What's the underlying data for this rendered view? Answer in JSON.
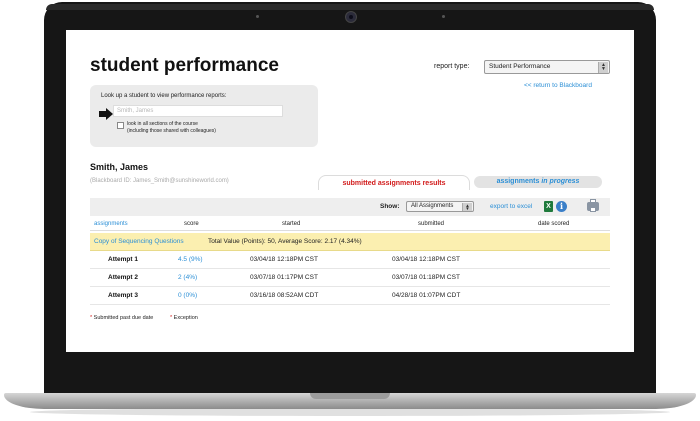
{
  "colors": {
    "accent_link": "#2b8fd6",
    "active_tab": "#d11a1a",
    "highlight_row": "#fbefb0"
  },
  "page": {
    "title": "student performance"
  },
  "report": {
    "type_label": "report type:",
    "type_value": "Student Performance",
    "back_link": "<< return to Blackboard"
  },
  "lookup": {
    "label": "Look up a student to view performance reports:",
    "placeholder": "Smith, James",
    "checkbox_label_line1": "look in all sections of the course",
    "checkbox_label_line2": "(including those shared with colleagues)"
  },
  "student": {
    "name": "Smith, James",
    "blackboard_id": "(Blackboard ID: James_Smith@sunshineworld.com)"
  },
  "tabs": {
    "active": "submitted assignments results",
    "inactive_prefix": "assignments",
    "inactive_emph": "in progress"
  },
  "toolbar": {
    "show_label": "Show:",
    "show_value": "All Assignments",
    "export_label": "export to excel",
    "excel_icon": "X",
    "info_icon": "i"
  },
  "table": {
    "headers": {
      "assignments": "assignments",
      "score": "score",
      "started": "started",
      "submitted": "submitted",
      "date_scored": "date scored"
    },
    "group": {
      "name": "Copy of Sequencing Questions",
      "summary": "Total Value (Points): 50, Average Score: 2.17 (4.34%)"
    },
    "rows": [
      {
        "name": "Attempt 1",
        "score": "4.5 (9%)",
        "started": "03/04/18  12:18PM  CST",
        "submitted": "03/04/18  12:18PM  CST"
      },
      {
        "name": "Attempt 2",
        "score": "2 (4%)",
        "started": "03/07/18  01:17PM  CST",
        "submitted": "03/07/18  01:18PM  CST"
      },
      {
        "name": "Attempt 3",
        "score": "0 (0%)",
        "started": "03/16/18  08:52AM  CDT",
        "submitted": "04/28/18  01:07PM  CDT"
      }
    ]
  },
  "legend": {
    "star": "*",
    "past_due": "Submitted past due date",
    "exception": "Exception"
  }
}
